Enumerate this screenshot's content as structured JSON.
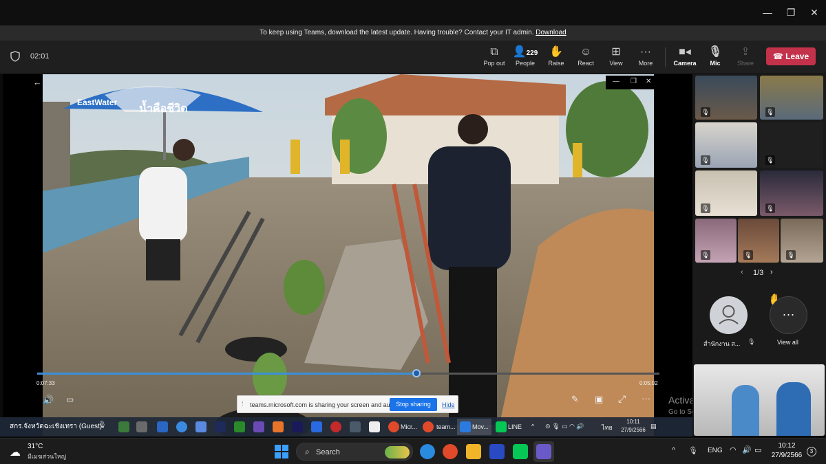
{
  "banner": {
    "message": "To keep using Teams, download the latest update. Having trouble? Contact your IT admin.",
    "link": "Download"
  },
  "meeting": {
    "timer": "02:01",
    "toolbar": {
      "popout": "Pop out",
      "people_count": "229",
      "people": "People",
      "raise": "Raise",
      "react": "React",
      "view": "View",
      "more": "More",
      "camera": "Camera",
      "mic": "Mic",
      "share": "Share",
      "leave": "Leave"
    }
  },
  "shared_video": {
    "elapsed": "0:07:33",
    "remaining": "0:05:02",
    "progress_fraction": 0.61,
    "umbrella_brand": "EastWater",
    "umbrella_slogan": "น้ำคือชีวิต"
  },
  "share_notice": {
    "text": "teams.microsoft.com is sharing your screen and audio.",
    "stop": "Stop sharing",
    "hide": "Hide"
  },
  "watermark": {
    "line1": "Activate Windows",
    "line2": "Go to Settings to activate Windows."
  },
  "participants": {
    "pager": "1/3",
    "avatar_name": "สำนักงาน ส...",
    "view_all": "View all",
    "guest_label": "สกร.จังหวัดฉะเชิงเทรา (Guest)"
  },
  "inner_taskbar": {
    "apps": [
      "Micr...",
      "team...",
      "Mov...",
      "LINE"
    ],
    "language": "ไทย",
    "time": "10:11",
    "date": "27/9/2566"
  },
  "taskbar": {
    "weather_temp": "31°C",
    "weather_desc": "มีเมฆส่วนใหญ่",
    "search": "Search",
    "language": "ENG",
    "time": "10:12",
    "date": "27/9/2566",
    "notification_count": "3"
  },
  "colors": {
    "leave": "#c4314b",
    "accent": "#3b8fd9",
    "stop_sharing": "#1a73e8"
  }
}
